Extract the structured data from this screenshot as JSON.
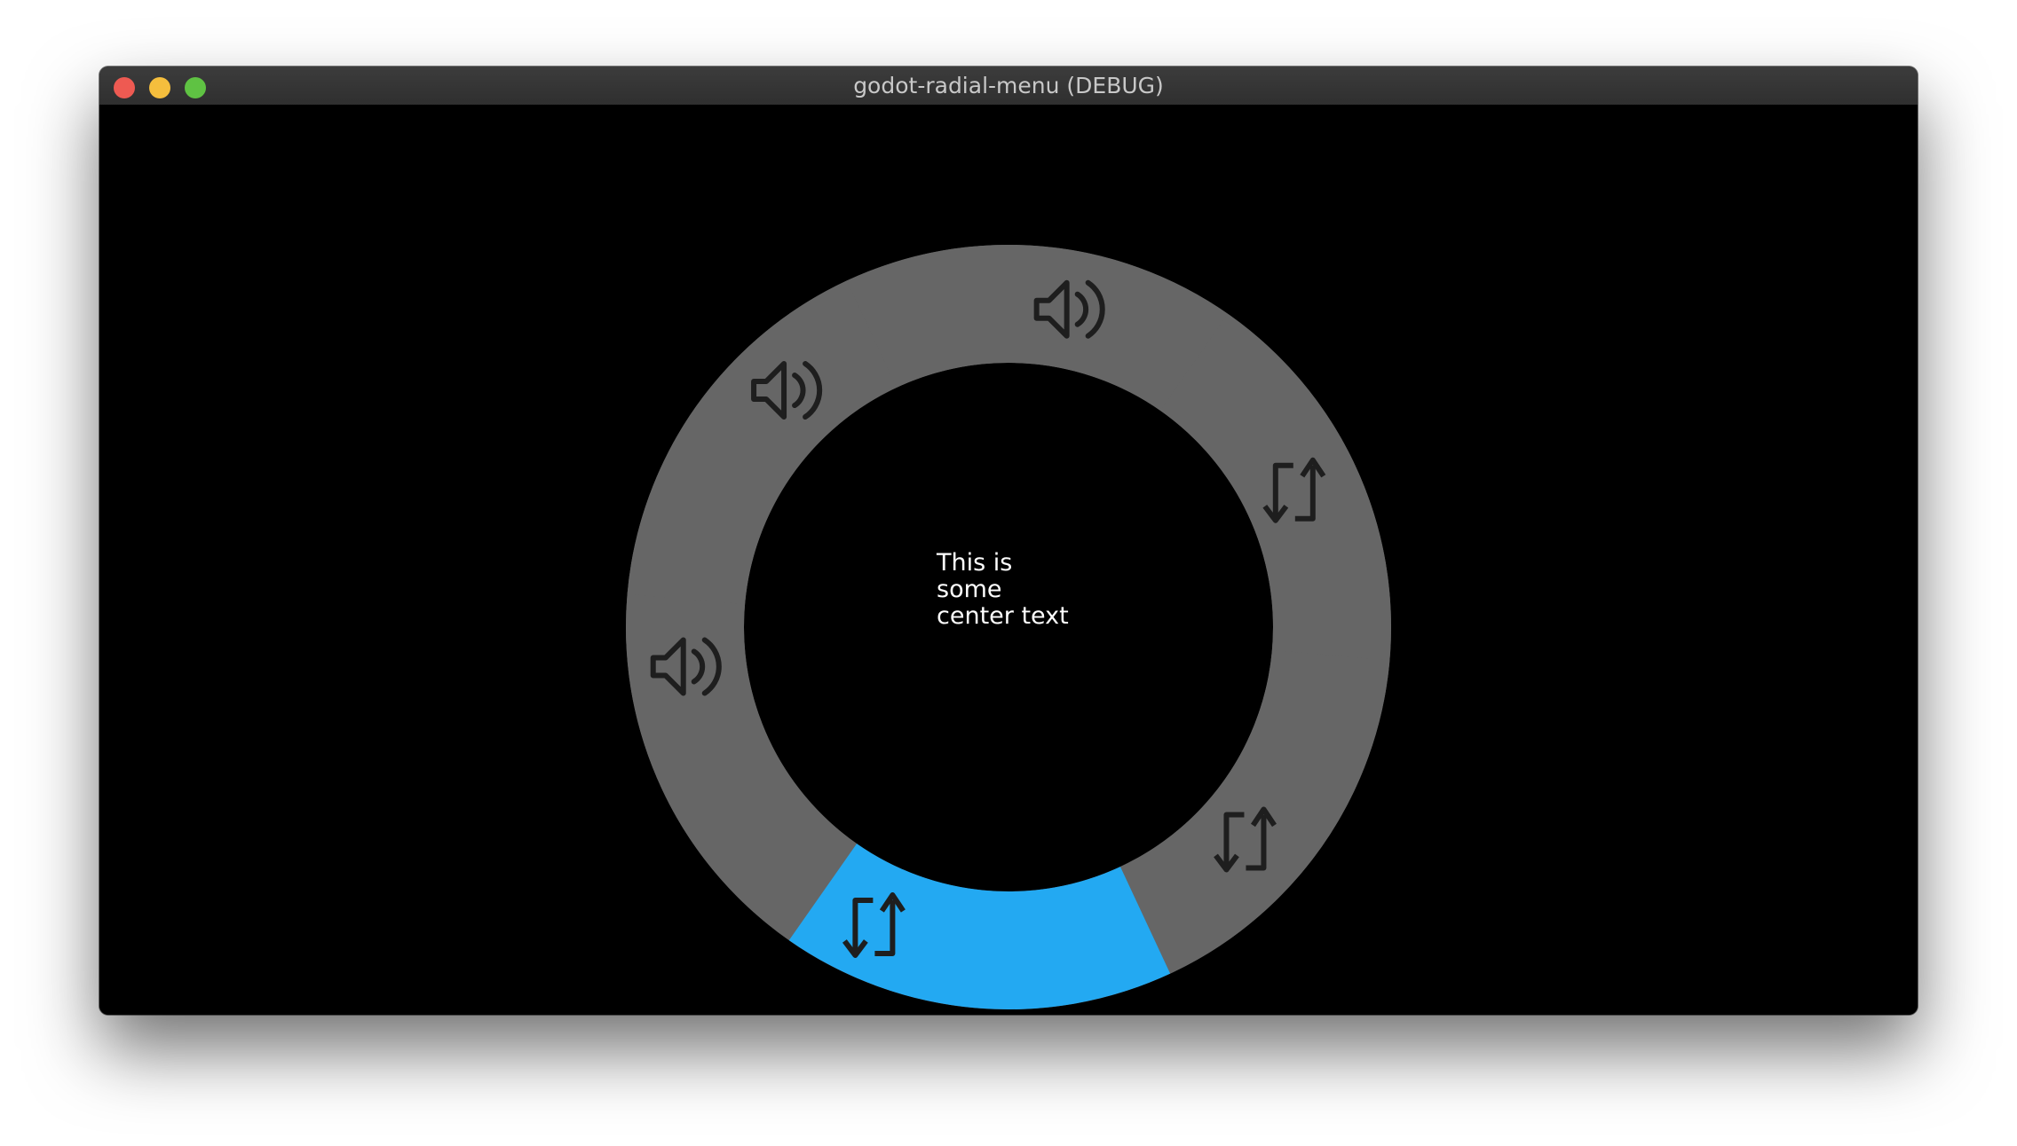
{
  "window": {
    "title": "godot-radial-menu (DEBUG)"
  },
  "titlebar": {
    "buttons": [
      {
        "name": "close",
        "color": "#ee5a52"
      },
      {
        "name": "minimize",
        "color": "#f5be3d"
      },
      {
        "name": "maximize",
        "color": "#5fc243"
      }
    ]
  },
  "radial_menu": {
    "ring_color": "#666666",
    "selected_color": "#23a9f2",
    "icon_color": "#1e1e1e",
    "selected_index": 5,
    "items": [
      {
        "icon": "speaker-icon"
      },
      {
        "icon": "speaker-icon"
      },
      {
        "icon": "speaker-icon"
      },
      {
        "icon": "swap-arrows-icon"
      },
      {
        "icon": "swap-arrows-icon"
      },
      {
        "icon": "swap-arrows-icon"
      }
    ],
    "center_text": {
      "line1": "This is",
      "line2": "some",
      "line3": "center text"
    }
  }
}
